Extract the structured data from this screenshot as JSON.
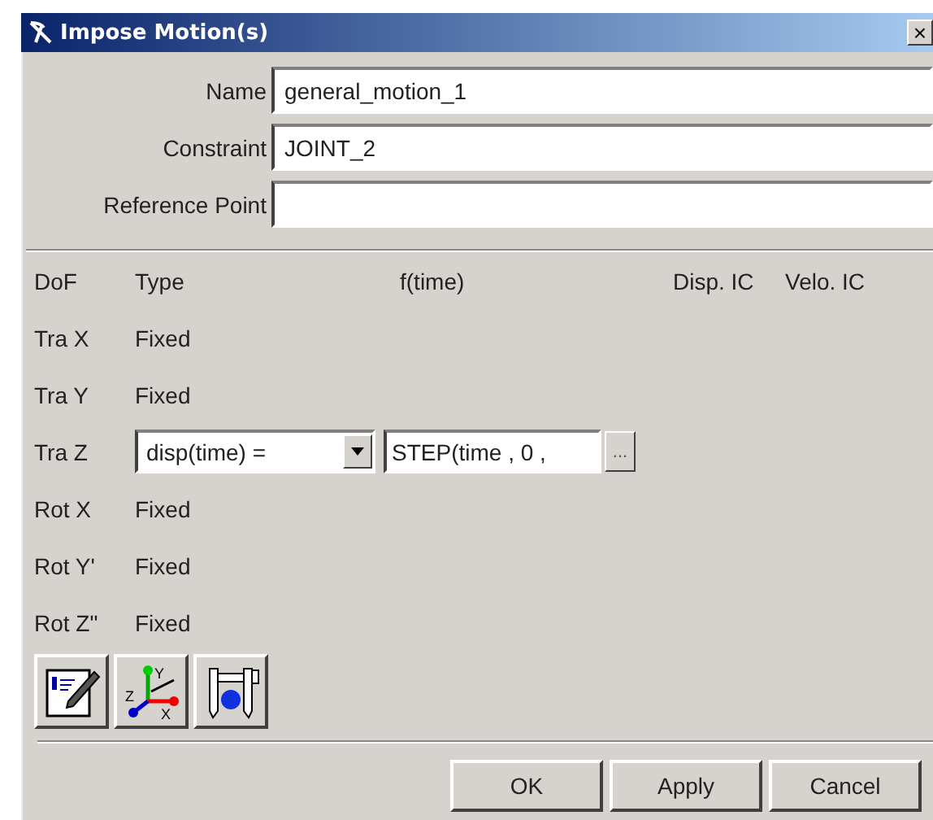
{
  "window": {
    "title": "Impose Motion(s)",
    "close": "×"
  },
  "fields": [
    {
      "label": "Name",
      "value": "general_motion_1"
    },
    {
      "label": "Constraint",
      "value": "JOINT_2"
    },
    {
      "label": "Reference Point"
    }
  ],
  "columns": [
    "DoF",
    "Type",
    "f(time)",
    "Disp. IC",
    "Velo. IC"
  ],
  "rows": [
    {
      "dof": "Tra X",
      "kind": "fixed",
      "type": "Fixed"
    },
    {
      "dof": "Tra Y",
      "kind": "fixed",
      "type": "Fixed"
    },
    {
      "dof": "Tra Z",
      "kind": "motion",
      "type": "disp(time) =",
      "function": "STEP(time , 0 ,",
      "browse": "..."
    },
    {
      "dof": "Rot X",
      "kind": "fixed",
      "type": "Fixed"
    },
    {
      "dof": "Rot Y'",
      "kind": "fixed",
      "type": "Fixed"
    },
    {
      "dof": "Rot Z\"",
      "kind": "fixed",
      "type": "Fixed"
    }
  ],
  "tools": [
    {
      "kind": "edit"
    },
    {
      "kind": "axes",
      "labels": [
        "Y",
        "Z",
        "X"
      ]
    },
    {
      "kind": "measure"
    }
  ],
  "buttons": [
    "OK",
    "Apply",
    "Cancel"
  ]
}
